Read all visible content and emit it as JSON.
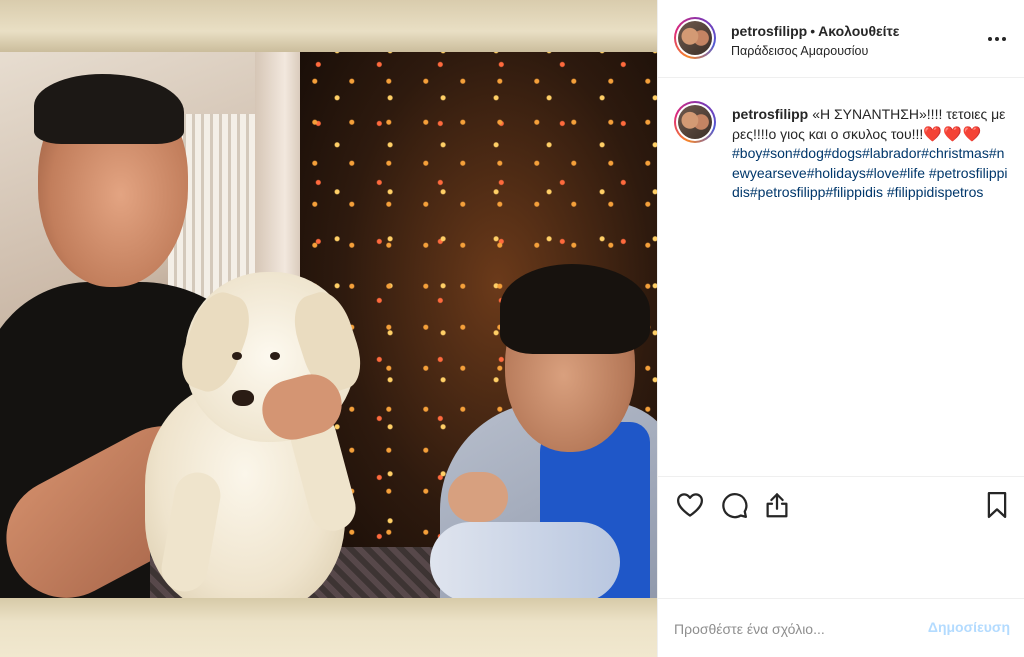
{
  "post": {
    "username": "petrosfilipp",
    "separator": "•",
    "follow_status": "Ακολουθείτε",
    "location": "Παράδεισος Αμαρουσίου",
    "avatar_icon": "profile-avatar",
    "more_icon": "more-options-icon"
  },
  "caption": {
    "username": "petrosfilipp",
    "text": "«Η ΣΥΝΑΝΤΗΣΗ»!!!! τετοιες μερες!!!!ο γιος και ο σκυλος του!!!",
    "hearts": "❤️❤️❤️",
    "hashtags": "#boy#son#dog#dogs#labrador#christmas#newyearseve#holidays#love#life #petrosfilippidis#petrosfilipp#filippidis #filippidispetros"
  },
  "actions": {
    "like_icon": "heart-outline-icon",
    "comment_icon": "comment-bubble-icon",
    "share_icon": "share-upload-icon",
    "save_icon": "bookmark-icon"
  },
  "comment_box": {
    "placeholder": "Προσθέστε ένα σχόλιο...",
    "post_label": "Δημοσίευση"
  },
  "colors": {
    "text": "#262626",
    "hashtag": "#00376b",
    "post_button_disabled": "#b3dbff",
    "heart": "#e0141e",
    "border": "#efefef"
  }
}
